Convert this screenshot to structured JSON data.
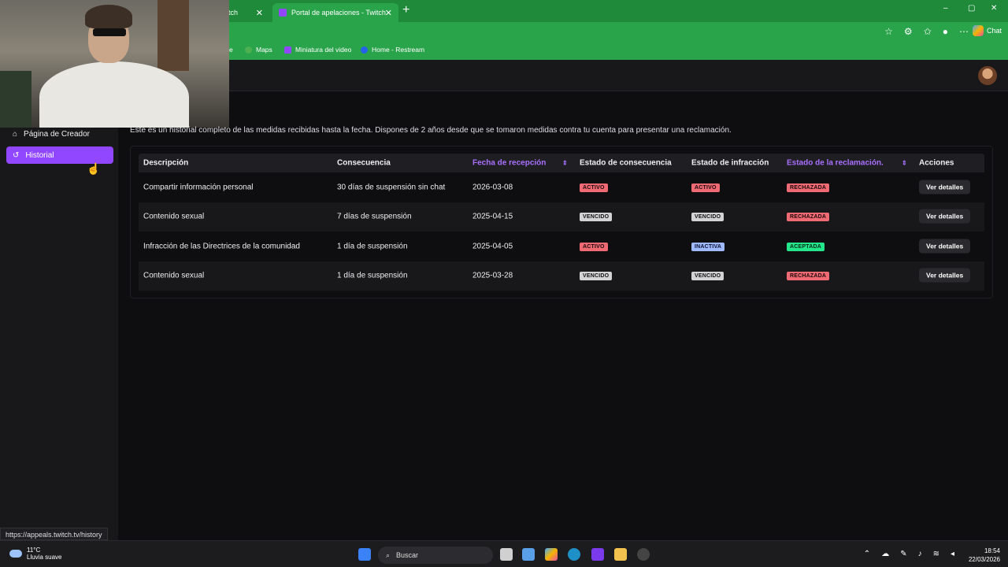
{
  "browser": {
    "tabs": [
      {
        "label": "itch"
      },
      {
        "label": "Portal de apelaciones - Twitch"
      }
    ],
    "new_tab": "+",
    "window_controls": [
      "–",
      "▢",
      "✕"
    ],
    "chat_label": "Chat",
    "bookmarks": [
      {
        "label": "e"
      },
      {
        "label": "Maps"
      },
      {
        "label": "Miniatura del video"
      },
      {
        "label": "Home - Restream"
      }
    ],
    "status_url": "https://appeals.twitch.tv/history"
  },
  "sidebar": {
    "items": [
      {
        "label": "Página de Creador"
      },
      {
        "label": "Historial"
      }
    ]
  },
  "main": {
    "intro": "Este es un historial completo de las medidas recibidas hasta la fecha. Dispones de 2 años desde que se tomaron medidas contra tu cuenta para presentar una reclamación.",
    "headers": [
      "Descripción",
      "Consecuencia",
      "Fecha de recepción",
      "Estado de consecuencia",
      "Estado de infracción",
      "Estado de la reclamación.",
      "Acciones"
    ],
    "rows": [
      {
        "descripcion": "Compartir información personal",
        "consecuencia": "30 días de suspensión sin chat",
        "fecha": "2026-03-08",
        "estado_consecuencia": "ACTIVO",
        "estado_infraccion": "ACTIVO",
        "estado_reclamacion": "RECHAZADA",
        "accion": "Ver detalles"
      },
      {
        "descripcion": "Contenido sexual",
        "consecuencia": "7 días de suspensión",
        "fecha": "2025-04-15",
        "estado_consecuencia": "VENCIDO",
        "estado_infraccion": "VENCIDO",
        "estado_reclamacion": "RECHAZADA",
        "accion": "Ver detalles"
      },
      {
        "descripcion": "Infracción de las Directrices de la comunidad",
        "consecuencia": "1 día de suspensión",
        "fecha": "2025-04-05",
        "estado_consecuencia": "ACTIVO",
        "estado_infraccion": "INACTIVA",
        "estado_reclamacion": "ACEPTADA",
        "accion": "Ver detalles"
      },
      {
        "descripcion": "Contenido sexual",
        "consecuencia": "1 día de suspensión",
        "fecha": "2025-03-28",
        "estado_consecuencia": "VENCIDO",
        "estado_infraccion": "VENCIDO",
        "estado_reclamacion": "RECHAZADA",
        "accion": "Ver detalles"
      }
    ]
  },
  "taskbar": {
    "temperature": "11°C",
    "weather": "Lluvia suave",
    "search_placeholder": "Buscar",
    "time": "18:54",
    "date": "22/03/2026"
  },
  "colors": {
    "accent": "#9146ff",
    "browser_green": "#2aa44b",
    "badge_red": "#f06a74",
    "badge_grey": "#d3d3d6",
    "badge_blue": "#9fb9ff",
    "badge_green": "#23e58a"
  }
}
